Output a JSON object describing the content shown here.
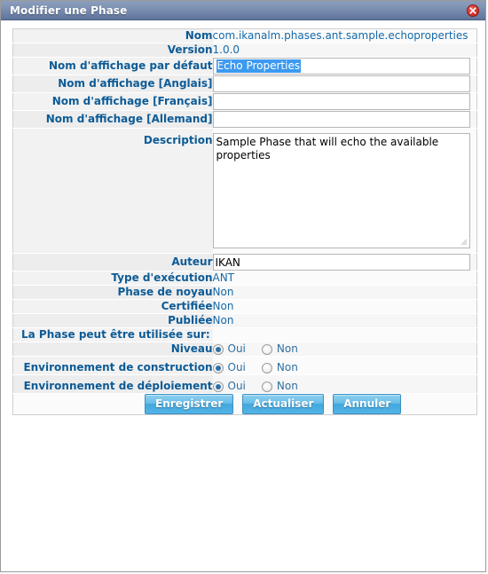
{
  "window": {
    "title": "Modifier une Phase",
    "close_icon": "close-icon"
  },
  "form": {
    "rows": [
      {
        "label": "Nom",
        "value": "com.ikanalm.phases.ant.sample.echoproperties"
      },
      {
        "label": "Version",
        "value": "1.0.0"
      },
      {
        "label": "Nom d'affichage par défaut",
        "value": "Echo Properties"
      },
      {
        "label": "Nom d'affichage [Anglais]",
        "value": ""
      },
      {
        "label": "Nom d'affichage [Français]",
        "value": ""
      },
      {
        "label": "Nom d'affichage [Allemand]",
        "value": ""
      },
      {
        "label": "Description",
        "value": "Sample Phase that will echo the available properties"
      },
      {
        "label": "Auteur",
        "value": "IKAN"
      },
      {
        "label": "Type d'exécution",
        "value": "ANT"
      },
      {
        "label": "Phase de noyau",
        "value": "Non"
      },
      {
        "label": "Certifiée",
        "value": "Non"
      },
      {
        "label": "Publiée",
        "value": "Non"
      }
    ],
    "section_header": "La Phase peut être utilisée sur:",
    "radio_rows": [
      {
        "label": "Niveau",
        "yes": "Oui",
        "no": "Non",
        "selected": "Oui"
      },
      {
        "label": "Environnement de construction",
        "yes": "Oui",
        "no": "Non",
        "selected": "Oui"
      },
      {
        "label": "Environnement de déploiement",
        "yes": "Oui",
        "no": "Non",
        "selected": "Oui"
      }
    ]
  },
  "buttons": {
    "save": "Enregistrer",
    "refresh": "Actualiser",
    "cancel": "Annuler"
  },
  "colors": {
    "title_bar": "#5e749c",
    "label_text": "#0d5b96",
    "value_text": "#1569a8",
    "selection": "#3c9af0",
    "button": "#54b4e6",
    "close": "#d5322c"
  }
}
